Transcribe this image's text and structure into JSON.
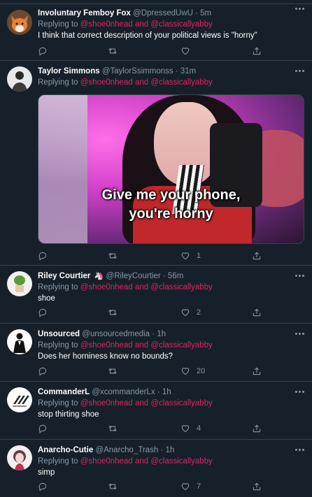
{
  "colors": {
    "background": "#15202b",
    "border": "#38444d",
    "secondary": "#8899a6",
    "mention": "#e0245e"
  },
  "tweets": [
    {
      "name": "Involuntary Femboy Fox",
      "handle": "@DpressedUwU",
      "time": "· 5m",
      "reply_prefix": "Replying to",
      "mention1": "@shoe0nhead",
      "and": "and",
      "mention2": "@classicallyabby",
      "text": "I think that correct description of your political views is \"horny\"",
      "likes": ""
    },
    {
      "name": "Taylor Simmons",
      "handle": "@TaylorSsimmonss",
      "time": "· 31m",
      "reply_prefix": "Replying to",
      "mention1": "@shoe0nhead",
      "and": "and",
      "mention2": "@classicallyabby",
      "text": "",
      "media_caption": "Give me your phone,\nyou're horny",
      "likes": "1"
    },
    {
      "name": "Riley Courtier",
      "badge": "🦄",
      "handle": "@RileyCourtier",
      "time": "· 56m",
      "reply_prefix": "Replying to",
      "mention1": "@shoe0nhead",
      "and": "and",
      "mention2": "@classicallyabby",
      "text": "shoe",
      "likes": "2"
    },
    {
      "name": "Unsourced",
      "handle": "@unsourcedmedia",
      "time": "· 1h",
      "reply_prefix": "Replying to",
      "mention1": "@shoe0nhead",
      "and": "and",
      "mention2": "@classicallyabby",
      "text": "Does her horniness know no bounds?",
      "likes": "20"
    },
    {
      "name": "CommanderL",
      "handle": "@xcommanderLx",
      "time": "· 1h",
      "reply_prefix": "Replying to",
      "mention1": "@shoe0nhead",
      "and": "and",
      "mention2": "@classicallyabby",
      "text": "stop thirting shoe",
      "likes": "4"
    },
    {
      "name": "Anarcho-Cutie",
      "handle": "@Anarcho_Trash",
      "time": "· 1h",
      "reply_prefix": "Replying to",
      "mention1": "@shoe0nhead",
      "and": "and",
      "mention2": "@classicallyabby",
      "text": "simp",
      "likes": "7"
    }
  ],
  "icons": {
    "reply": "reply-icon",
    "retweet": "retweet-icon",
    "like": "heart-icon",
    "share": "share-icon",
    "more": "more-icon"
  }
}
